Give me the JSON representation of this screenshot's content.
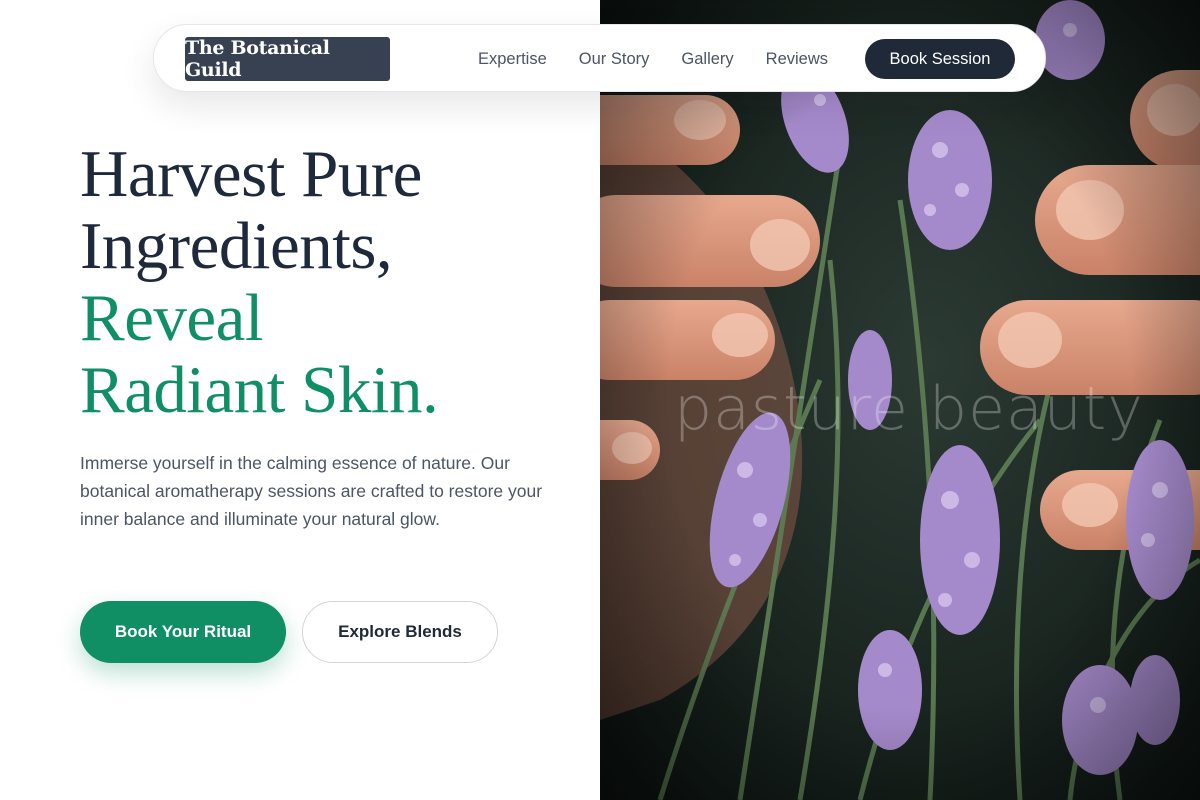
{
  "brand": {
    "logo_text": "The Botanical Guild"
  },
  "nav": {
    "links": [
      {
        "label": "Expertise"
      },
      {
        "label": "Our Story"
      },
      {
        "label": "Gallery"
      },
      {
        "label": "Reviews"
      }
    ],
    "cta_label": "Book Session"
  },
  "hero": {
    "headline_lines": [
      "Harvest Pure",
      "Ingredients,",
      "Reveal",
      "Radiant Skin."
    ],
    "body": "Immerse yourself in the calming essence of nature. Our botanical aromatherapy sessions are crafted to restore your inner balance and illuminate your natural glow.",
    "primary_button": "Book Your Ritual",
    "secondary_button": "Explore Blends"
  },
  "photo": {
    "watermark_text": "pasture beauty",
    "subject": "hands among lavender flowers"
  },
  "colors": {
    "accent_green": "#0f8f63",
    "headline_dark": "#1e293b",
    "nav_dark": "#1f2937",
    "logo_bg": "#374151",
    "body_text": "#4b5563"
  }
}
